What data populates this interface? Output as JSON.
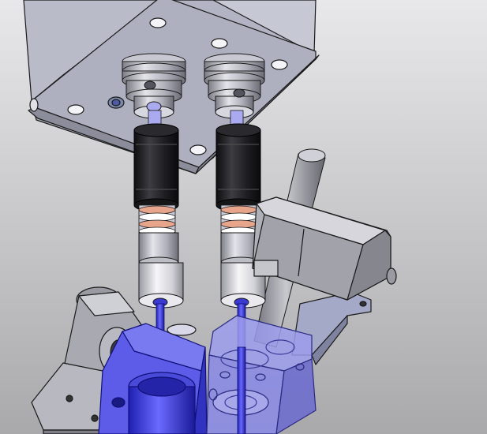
{
  "scene": {
    "kind": "cad-3d-assembly-render",
    "background": {
      "top_color": "#e8e8ea",
      "bottom_color": "#a9a9ab"
    },
    "colors": {
      "gray_light": "#cfcfd6",
      "gray_mid": "#b5b5be",
      "gray_dark": "#8e8e98",
      "steel_blue": "#a6aacb",
      "blue_part": "#5f5ff0",
      "blue_deep": "#3030c8",
      "blue_translucent": "#8a8ae6",
      "black_part": "#1e1e20",
      "copper": "#d88a6a",
      "edge": "#1a1a1a"
    },
    "parts": [
      "top-mounting-plate",
      "left-nut-housing",
      "right-nut-housing",
      "left-black-sleeve",
      "right-black-sleeve",
      "left-spring",
      "right-spring",
      "left-white-coupler",
      "right-white-coupler",
      "left-blue-shaft",
      "right-blue-shaft",
      "vertical-rod",
      "side-bracket",
      "left-gray-bracket",
      "left-blue-block",
      "right-translucent-block"
    ]
  }
}
